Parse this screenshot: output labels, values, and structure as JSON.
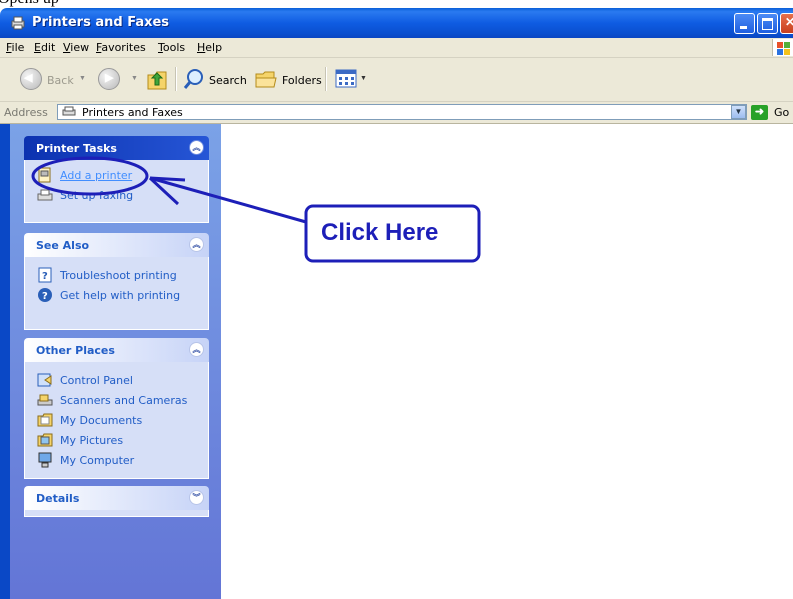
{
  "caption_cropped": "Opens up",
  "window": {
    "title": "Printers and Faxes"
  },
  "menu": [
    "File",
    "Edit",
    "View",
    "Favorites",
    "Tools",
    "Help"
  ],
  "toolbar": {
    "back": "Back",
    "search": "Search",
    "folders": "Folders"
  },
  "address": {
    "label": "Address",
    "value": "Printers and Faxes",
    "go": "Go"
  },
  "panels": {
    "printer_tasks": {
      "title": "Printer Tasks",
      "items": [
        "Add a printer",
        "Set up faxing"
      ]
    },
    "see_also": {
      "title": "See Also",
      "items": [
        "Troubleshoot printing",
        "Get help with printing"
      ]
    },
    "other_places": {
      "title": "Other Places",
      "items": [
        "Control Panel",
        "Scanners and Cameras",
        "My Documents",
        "My Pictures",
        "My Computer"
      ]
    },
    "details": {
      "title": "Details"
    }
  },
  "annotation": {
    "label": "Click Here",
    "color": "#1d1fb8"
  },
  "colors": {
    "titlebar": "#0a5fd8",
    "left_pane": "#7ba2e7",
    "link": "#215dc6"
  }
}
